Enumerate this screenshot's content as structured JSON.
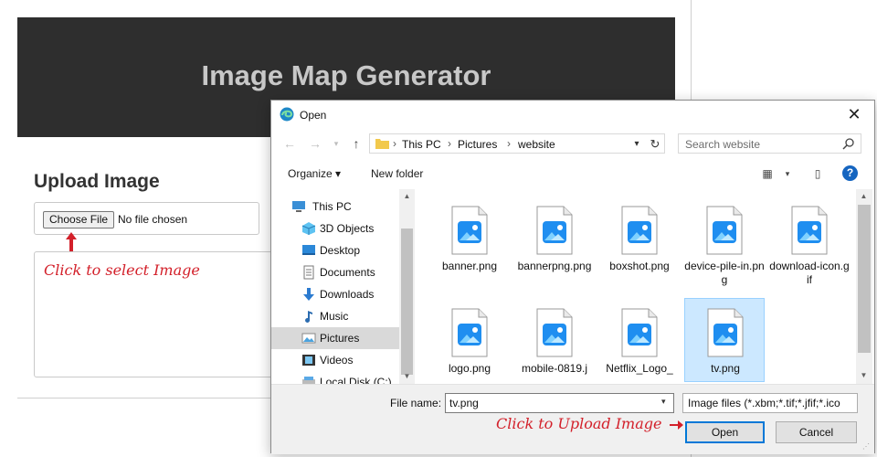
{
  "page": {
    "banner_title": "Image Map Generator",
    "section_title": "Upload Image",
    "choose_file_label": "Choose File",
    "no_file_text": "No file chosen",
    "annotation_select": "Click to select Image",
    "annotation_upload": "Click to Upload Image",
    "annotation_color": "#d3202a"
  },
  "dialog": {
    "title": "Open",
    "close_label": "✕",
    "breadcrumb": [
      "This PC",
      "Pictures",
      "website"
    ],
    "search_placeholder": "Search website",
    "organize_label": "Organize ▾",
    "new_folder_label": "New folder",
    "help_label": "?",
    "nav_items": [
      {
        "label": "This PC",
        "icon": "computer-icon"
      },
      {
        "label": "3D Objects",
        "icon": "cube-icon"
      },
      {
        "label": "Desktop",
        "icon": "desktop-icon"
      },
      {
        "label": "Documents",
        "icon": "documents-icon"
      },
      {
        "label": "Downloads",
        "icon": "download-arrow-icon"
      },
      {
        "label": "Music",
        "icon": "music-note-icon"
      },
      {
        "label": "Pictures",
        "icon": "pictures-icon",
        "selected": true
      },
      {
        "label": "Videos",
        "icon": "film-icon"
      },
      {
        "label": "Local Disk (C:)",
        "icon": "disk-icon"
      }
    ],
    "files": [
      {
        "name": "banner.png"
      },
      {
        "name": "bannerpng.png"
      },
      {
        "name": "boxshot.png"
      },
      {
        "name": "device-pile-in.png"
      },
      {
        "name": "download-icon.gif"
      },
      {
        "name": "logo.png"
      },
      {
        "name": "mobile-0819.j"
      },
      {
        "name": "Netflix_Logo_"
      },
      {
        "name": "tv.png",
        "selected": true
      }
    ],
    "file_name_label": "File name:",
    "file_name_value": "tv.png",
    "file_type_filter": "Image files (*.xbm;*.tif;*.jfif;*.ico",
    "open_label": "Open",
    "cancel_label": "Cancel",
    "accent_color": "#0078d7"
  }
}
